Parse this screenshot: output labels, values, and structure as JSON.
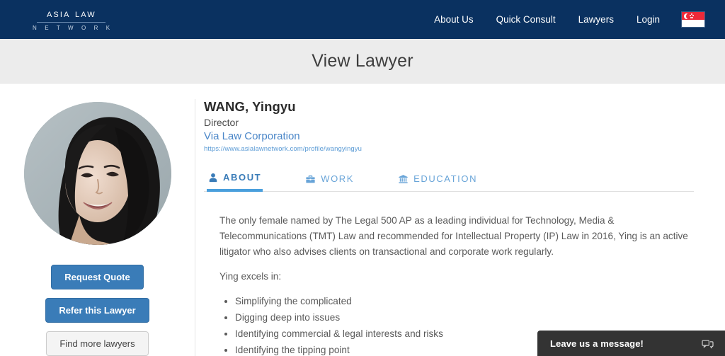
{
  "header": {
    "logo": {
      "main": "Asia Law",
      "sub": "N E T W O R K"
    },
    "nav": [
      {
        "label": "About Us",
        "name": "nav-about-us"
      },
      {
        "label": "Quick Consult",
        "name": "nav-quick-consult"
      },
      {
        "label": "Lawyers",
        "name": "nav-lawyers"
      },
      {
        "label": "Login",
        "name": "nav-login"
      }
    ],
    "flag": {
      "country": "Singapore",
      "icon": "singapore-flag-icon"
    },
    "colors": {
      "background": "#0a3160",
      "text": "#ffffff"
    }
  },
  "page_title": "View Lawyer",
  "profile": {
    "avatar_alt": "lawyer-portrait",
    "name": "WANG, Yingyu",
    "title": "Director",
    "firm": "Via Law Corporation",
    "profile_url": "https://www.asialawnetwork.com/profile/wangyingyu"
  },
  "actions": [
    {
      "label": "Request Quote",
      "style": "primary",
      "name": "request-quote-button"
    },
    {
      "label": "Refer this Lawyer",
      "style": "primary",
      "name": "refer-lawyer-button"
    },
    {
      "label": "Find more lawyers",
      "style": "default",
      "name": "find-more-lawyers-button"
    }
  ],
  "tabs": [
    {
      "label": "About",
      "icon": "person-icon",
      "active": true,
      "name": "tab-about"
    },
    {
      "label": "Work",
      "icon": "briefcase-icon",
      "active": false,
      "name": "tab-work"
    },
    {
      "label": "Education",
      "icon": "bank-icon",
      "active": false,
      "name": "tab-education"
    }
  ],
  "about": {
    "paragraph1": "The only female named by The Legal 500 AP as a leading individual for Technology, Media & Telecommunications (TMT) Law and recommended for Intellectual Property (IP) Law in 2016, Ying is an active litigator who also advises clients on transactional and corporate work regularly.",
    "paragraph2": "Ying excels in:",
    "bullets": [
      "Simplifying the complicated",
      "Digging deep into issues",
      "Identifying commercial & legal interests and risks",
      "Identifying the tipping point"
    ]
  },
  "chat": {
    "label": "Leave us a message!",
    "icon": "speech-bubble-icon",
    "background": "#333333"
  },
  "colors": {
    "header_navy": "#0a3160",
    "accent_blue": "#3a7cb8",
    "tab_blue": "#4a9fdc",
    "link_blue": "#5b9bd5",
    "band_gray": "#ececec"
  }
}
